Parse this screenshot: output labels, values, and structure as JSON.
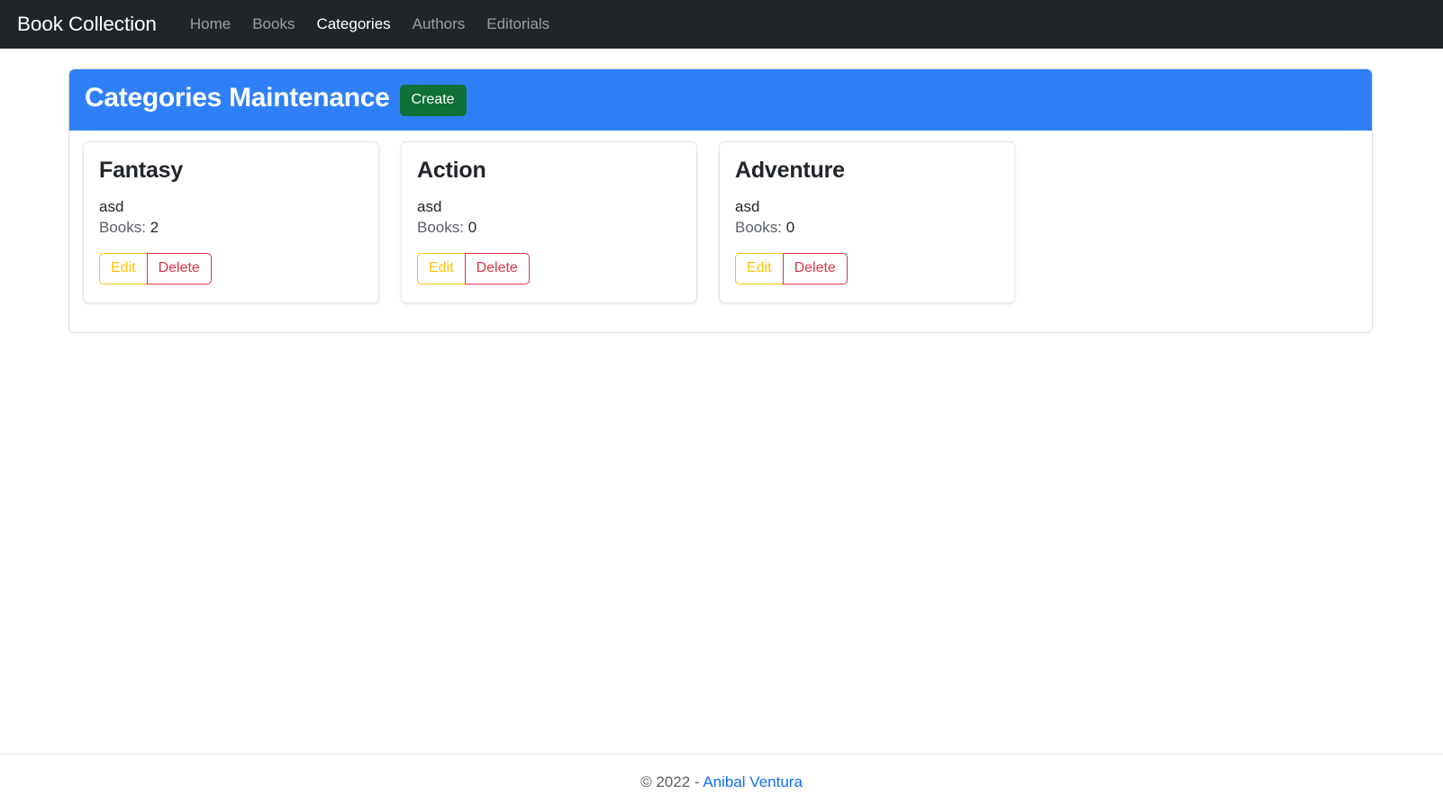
{
  "navbar": {
    "brand": "Book Collection",
    "links": [
      {
        "label": "Home",
        "active": false
      },
      {
        "label": "Books",
        "active": false
      },
      {
        "label": "Categories",
        "active": true
      },
      {
        "label": "Authors",
        "active": false
      },
      {
        "label": "Editorials",
        "active": false
      }
    ]
  },
  "panel": {
    "title": "Categories Maintenance",
    "create_label": "Create"
  },
  "cards": [
    {
      "title": "Fantasy",
      "description": "asd",
      "books_label": "Books:",
      "books_count": "2",
      "edit_label": "Edit",
      "delete_label": "Delete"
    },
    {
      "title": "Action",
      "description": "asd",
      "books_label": "Books:",
      "books_count": "0",
      "edit_label": "Edit",
      "delete_label": "Delete"
    },
    {
      "title": "Adventure",
      "description": "asd",
      "books_label": "Books:",
      "books_count": "0",
      "edit_label": "Edit",
      "delete_label": "Delete"
    }
  ],
  "footer": {
    "copyright": "© 2022 - ",
    "author": "Anibal Ventura"
  },
  "colors": {
    "navbar_bg": "#212529",
    "panel_header_bg": "#2f80f8",
    "create_green": "#0f7038",
    "edit_yellow": "#ffc107",
    "delete_red": "#dc3545",
    "link_blue": "#0d6efd"
  }
}
